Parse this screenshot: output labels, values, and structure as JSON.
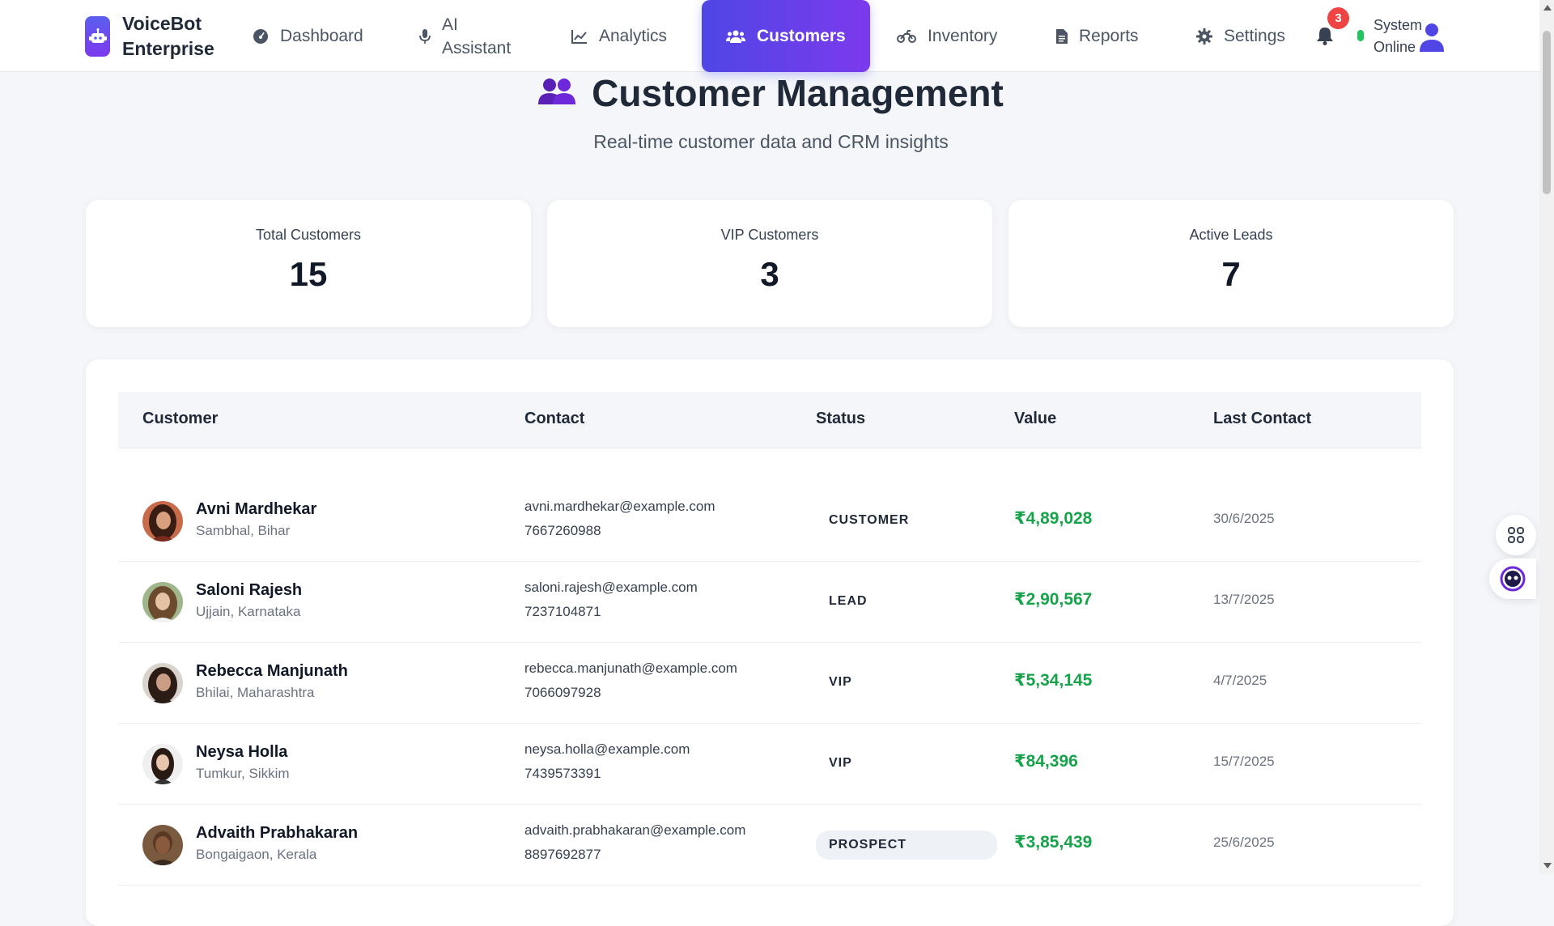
{
  "brand": {
    "name_line1": "VoiceBot",
    "name_line2": "Enterprise"
  },
  "nav": {
    "items": [
      {
        "label": "Dashboard",
        "icon": "gauge-icon"
      },
      {
        "label_line1": "AI",
        "label_line2": "Assistant",
        "icon": "microphone-icon"
      },
      {
        "label": "Analytics",
        "icon": "line-chart-icon"
      },
      {
        "label": "Customers",
        "icon": "users-icon",
        "active": true
      },
      {
        "label": "Inventory",
        "icon": "motorcycle-icon"
      },
      {
        "label": "Reports",
        "icon": "document-icon"
      },
      {
        "label": "Settings",
        "icon": "gear-icon"
      }
    ],
    "notification_count": "3",
    "status_line1": "System",
    "status_line2": "Online"
  },
  "page": {
    "title": "Customer Management",
    "subtitle": "Real-time customer data and CRM insights"
  },
  "stats": [
    {
      "label": "Total Customers",
      "value": "15"
    },
    {
      "label": "VIP Customers",
      "value": "3"
    },
    {
      "label": "Active Leads",
      "value": "7"
    }
  ],
  "table": {
    "headers": [
      "Customer",
      "Contact",
      "Status",
      "Value",
      "Last Contact"
    ],
    "rows": [
      {
        "name": "Avni Mardhekar",
        "location": "Sambhal, Bihar",
        "email": "avni.mardhekar@example.com",
        "phone": "7667260988",
        "status": "CUSTOMER",
        "value": "₹4,89,028",
        "last_contact": "30/6/2025"
      },
      {
        "name": "Saloni Rajesh",
        "location": "Ujjain, Karnataka",
        "email": "saloni.rajesh@example.com",
        "phone": "7237104871",
        "status": "LEAD",
        "value": "₹2,90,567",
        "last_contact": "13/7/2025"
      },
      {
        "name": "Rebecca Manjunath",
        "location": "Bhilai, Maharashtra",
        "email": "rebecca.manjunath@example.com",
        "phone": "7066097928",
        "status": "VIP",
        "value": "₹5,34,145",
        "last_contact": "4/7/2025"
      },
      {
        "name": "Neysa Holla",
        "location": "Tumkur, Sikkim",
        "email": "neysa.holla@example.com",
        "phone": "7439573391",
        "status": "VIP",
        "value": "₹84,396",
        "last_contact": "15/7/2025"
      },
      {
        "name": "Advaith Prabhakaran",
        "location": "Bongaigaon, Kerala",
        "email": "advaith.prabhakaran@example.com",
        "phone": "8897692877",
        "status": "PROSPECT",
        "value": "₹3,85,439",
        "last_contact": "25/6/2025"
      }
    ]
  },
  "colors": {
    "accent": "#4f46e5",
    "accent2": "#7c3aed",
    "value_green": "#16a34a",
    "badge_red": "#ef4444",
    "online_green": "#22c55e"
  }
}
